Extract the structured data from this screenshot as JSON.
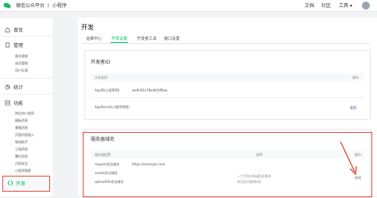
{
  "header": {
    "brand": "微信公众平台 丨 小程序",
    "links": [
      "文档",
      "社区",
      "工具 ▾"
    ]
  },
  "sidebar": {
    "home": "首页",
    "manage": "管理",
    "manage_items": [
      "版本管理",
      "成员管理",
      "用户反馈"
    ],
    "stats": "统计",
    "features": "功能",
    "feature_items": [
      "附近的小程序",
      "模板消息",
      "客服消息",
      "页面内容接入",
      "物流助手",
      "订阅消息",
      "曝光消息",
      "内容安全",
      "小程序搜索",
      "小程序评测"
    ],
    "active": "开发"
  },
  "main": {
    "title": "开发",
    "tabs": [
      "运维中心",
      "开发设置",
      "开发者工具",
      "接口设置"
    ],
    "dev_id_card": {
      "title": "开发者ID",
      "col_header": "开发者ID",
      "col_action": "操作",
      "rows": [
        {
          "label": "AppID(小程序ID)",
          "value": "wx8c81e78edb5df6ae",
          "action": ""
        },
        {
          "label": "AppSecret(小程序密钥)",
          "value": "",
          "action": "重置"
        }
      ]
    },
    "server_card": {
      "title": "服务器域名",
      "col_config": "服务器配置",
      "col_desc": "说明",
      "col_action": "操作",
      "rows": [
        {
          "label": "request合法域名",
          "value": "https://example.com",
          "action": "修改"
        },
        {
          "label": "socket合法域名",
          "value": "",
          "action": ""
        },
        {
          "label": "uploadFile合法域名",
          "value": "",
          "action": ""
        }
      ],
      "desc_lines": [
        "一个月内可申请5次修改",
        "本月还可修改4次"
      ]
    }
  },
  "colors": {
    "accent": "#07c160",
    "highlight": "#e54d42",
    "link": "#576b95"
  }
}
